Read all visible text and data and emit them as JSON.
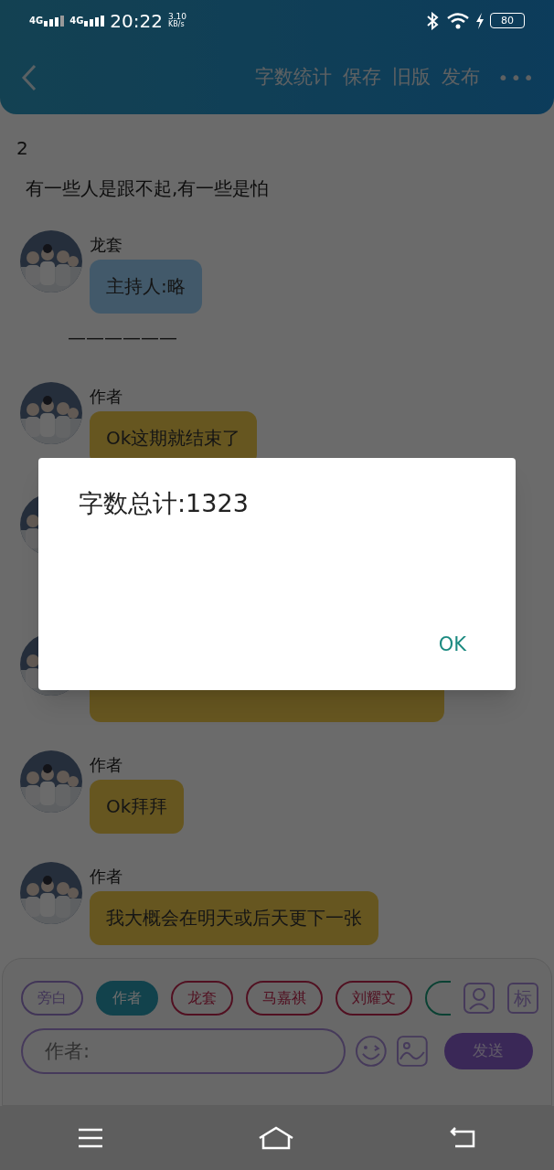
{
  "status_bar": {
    "network_1": "4G",
    "network_2": "4G",
    "time": "20:22",
    "speed": "3.10",
    "speed_unit": "KB/s",
    "battery": "80"
  },
  "header": {
    "actions": [
      "字数统计",
      "保存",
      "旧版",
      "发布"
    ],
    "more": "•••"
  },
  "lines": [
    {
      "kind": "plain",
      "text": "2"
    },
    {
      "kind": "narration",
      "text": "有一些人是跟不起,有一些是怕"
    },
    {
      "kind": "message",
      "name": "龙套",
      "text": "主持人:略",
      "color": "#42596a"
    },
    {
      "kind": "divider",
      "text": "——————"
    },
    {
      "kind": "message",
      "name": "作者",
      "text": "Ok这期就结束了",
      "color": "#665620"
    },
    {
      "kind": "message"
    },
    {
      "kind": "message",
      "color": "#665620"
    },
    {
      "kind": "message",
      "name": "作者",
      "text": "Ok拜拜",
      "color": "#665620"
    },
    {
      "kind": "message",
      "name": "作者",
      "text": "我大概会在明天或后天更下一张",
      "color": "#665620"
    }
  ],
  "characters": [
    {
      "label": "旁白",
      "color": "#413557",
      "selected": false
    },
    {
      "label": "作者",
      "color": "#12424c",
      "selected": true
    },
    {
      "label": "龙套",
      "color": "#511121",
      "selected": false
    },
    {
      "label": "马嘉祺",
      "color": "#511121",
      "selected": false
    },
    {
      "label": "刘耀文",
      "color": "#511121",
      "selected": false
    },
    {
      "color": "#0b4133",
      "selected": false
    }
  ],
  "tag_button": "标",
  "input": {
    "placeholder": "作者:"
  },
  "send": "发送",
  "dialog": {
    "message": "字数总计:1323",
    "button": "OK"
  }
}
